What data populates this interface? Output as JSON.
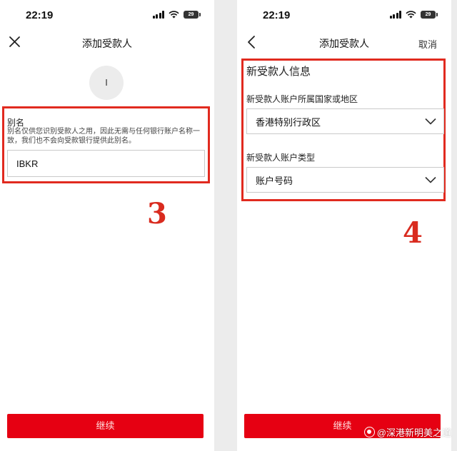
{
  "left_screen": {
    "status": {
      "time": "22:19",
      "battery": "29"
    },
    "title": "添加受款人",
    "avatar_initial": "I",
    "alias": {
      "label": "别名",
      "hint": "别名仅供您识别受款人之用，因此无需与任何银行账户名称一致，我们也不会向受款银行提供此别名。",
      "value": "IBKR"
    },
    "step": "3",
    "continue_label": "继续"
  },
  "right_screen": {
    "status": {
      "time": "22:19",
      "battery": "29"
    },
    "title": "添加受款人",
    "cancel_label": "取消",
    "section_title": "新受款人信息",
    "country": {
      "label": "新受款人账户所属国家或地区",
      "value": "香港特别行政区"
    },
    "account_type": {
      "label": "新受款人账户类型",
      "value": "账户号码"
    },
    "step": "4",
    "continue_label": "继续"
  },
  "watermark": "@深港新明美之道",
  "colors": {
    "accent_red": "#e60012",
    "annotation_red": "#e12a1f"
  }
}
